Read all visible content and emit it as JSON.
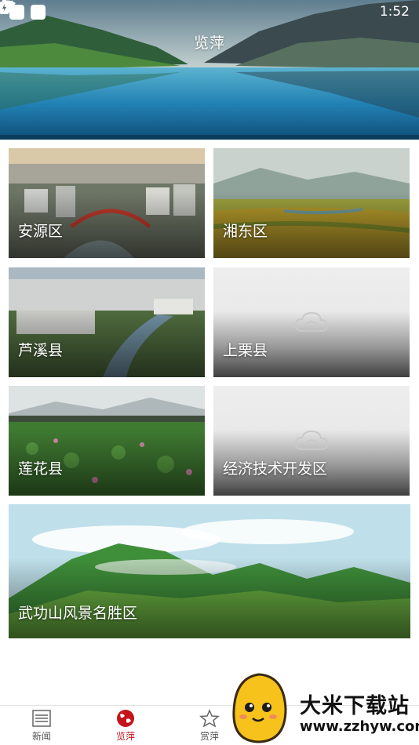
{
  "status_bar": {
    "time": "1:52"
  },
  "header": {
    "title": "览萍"
  },
  "regions": [
    {
      "label": "安源区",
      "has_image": true
    },
    {
      "label": "湘东区",
      "has_image": true
    },
    {
      "label": "芦溪县",
      "has_image": true
    },
    {
      "label": "上栗县",
      "has_image": false
    },
    {
      "label": "莲花县",
      "has_image": true
    },
    {
      "label": "经济技术开发区",
      "has_image": false
    },
    {
      "label": "武功山风景名胜区",
      "has_image": true
    }
  ],
  "bottom_nav": {
    "items": [
      {
        "label": "新闻",
        "icon": "newspaper-icon",
        "active": false
      },
      {
        "label": "览萍",
        "icon": "globe-icon",
        "active": true
      },
      {
        "label": "赏萍",
        "icon": "star-icon",
        "active": false
      }
    ]
  },
  "watermark": {
    "title": "大米下载站",
    "url": "www.zzhyw.com"
  },
  "colors": {
    "active_tab": "#c5141c",
    "inactive_tab": "#555555",
    "background": "#ffffff"
  }
}
